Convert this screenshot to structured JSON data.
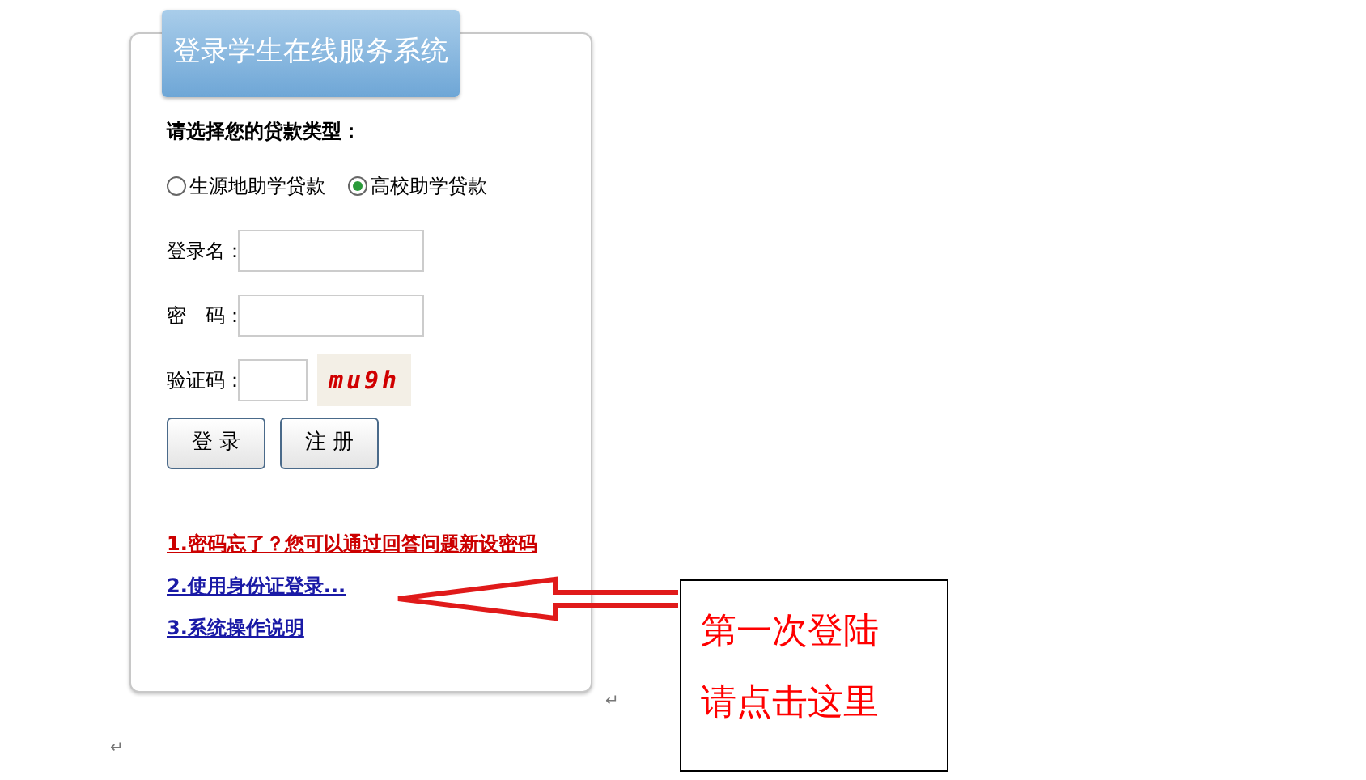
{
  "login_panel": {
    "title": "登录学生在线服务系统",
    "loan_type_label": "请选择您的贷款类型：",
    "loan_types": [
      {
        "label": "生源地助学贷款",
        "selected": false
      },
      {
        "label": "高校助学贷款",
        "selected": true
      }
    ],
    "fields": [
      {
        "label": "登录名：",
        "kind": "wide"
      },
      {
        "label": "密　码：",
        "kind": "wide"
      },
      {
        "label": "验证码：",
        "kind": "captcha",
        "captcha": "mu9h"
      }
    ],
    "buttons": [
      "登 录",
      "注 册"
    ],
    "links": [
      {
        "text": "1.密码忘了？您可以通过回答问题新设密码",
        "color": "#cc0000"
      },
      {
        "text": "2.使用身份证登录...",
        "color": "#1a1aa6"
      },
      {
        "text": "3.系统操作说明",
        "color": "#1a1aa6"
      }
    ]
  },
  "callout": {
    "lines": [
      "第一次登陆",
      "请点击这里"
    ]
  },
  "paragraph_marks": [
    "↵",
    "↵"
  ]
}
